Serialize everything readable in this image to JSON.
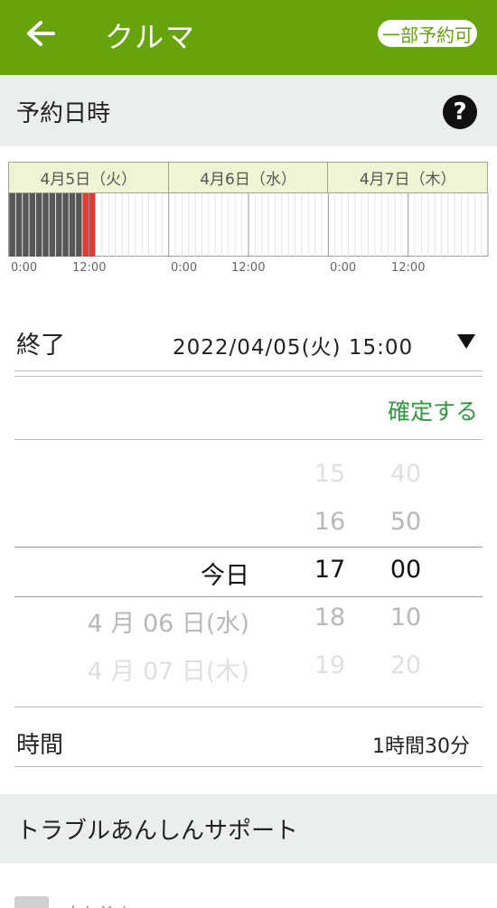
{
  "appbar": {
    "title": "クルマ",
    "badge": "一部予約可",
    "back_icon": "arrow-left-icon"
  },
  "reservation": {
    "section_label": "予約日時",
    "help_label": "?"
  },
  "timeline": {
    "days": [
      "4月5日（火）",
      "4月6日（水）",
      "4月7日（木）"
    ],
    "tick_labels": [
      "0:00",
      "12:00",
      "0:00",
      "12:00",
      "0:00",
      "12:00"
    ],
    "booked_color": "#575757",
    "selected_color": "#e53935"
  },
  "end": {
    "label": "終了",
    "value": "2022/04/05(火) 15:00"
  },
  "confirm_label": "確定する",
  "picker": {
    "day_column": [
      "",
      "",
      "今日",
      "4 月 06 日(水)",
      "4 月 07 日(木)"
    ],
    "hour_column": [
      "15",
      "16",
      "17",
      "18",
      "19"
    ],
    "minute_column": [
      "40",
      "50",
      "00",
      "10",
      "20"
    ]
  },
  "duration": {
    "label": "時間",
    "value": "1時間30分"
  },
  "support": {
    "section_label": "トラブルあんしんサポート",
    "apply_label": "申し込む"
  },
  "colors": {
    "brand": "#66a30c",
    "confirm": "#2e9a3e",
    "section_bg": "#eaeeec"
  }
}
